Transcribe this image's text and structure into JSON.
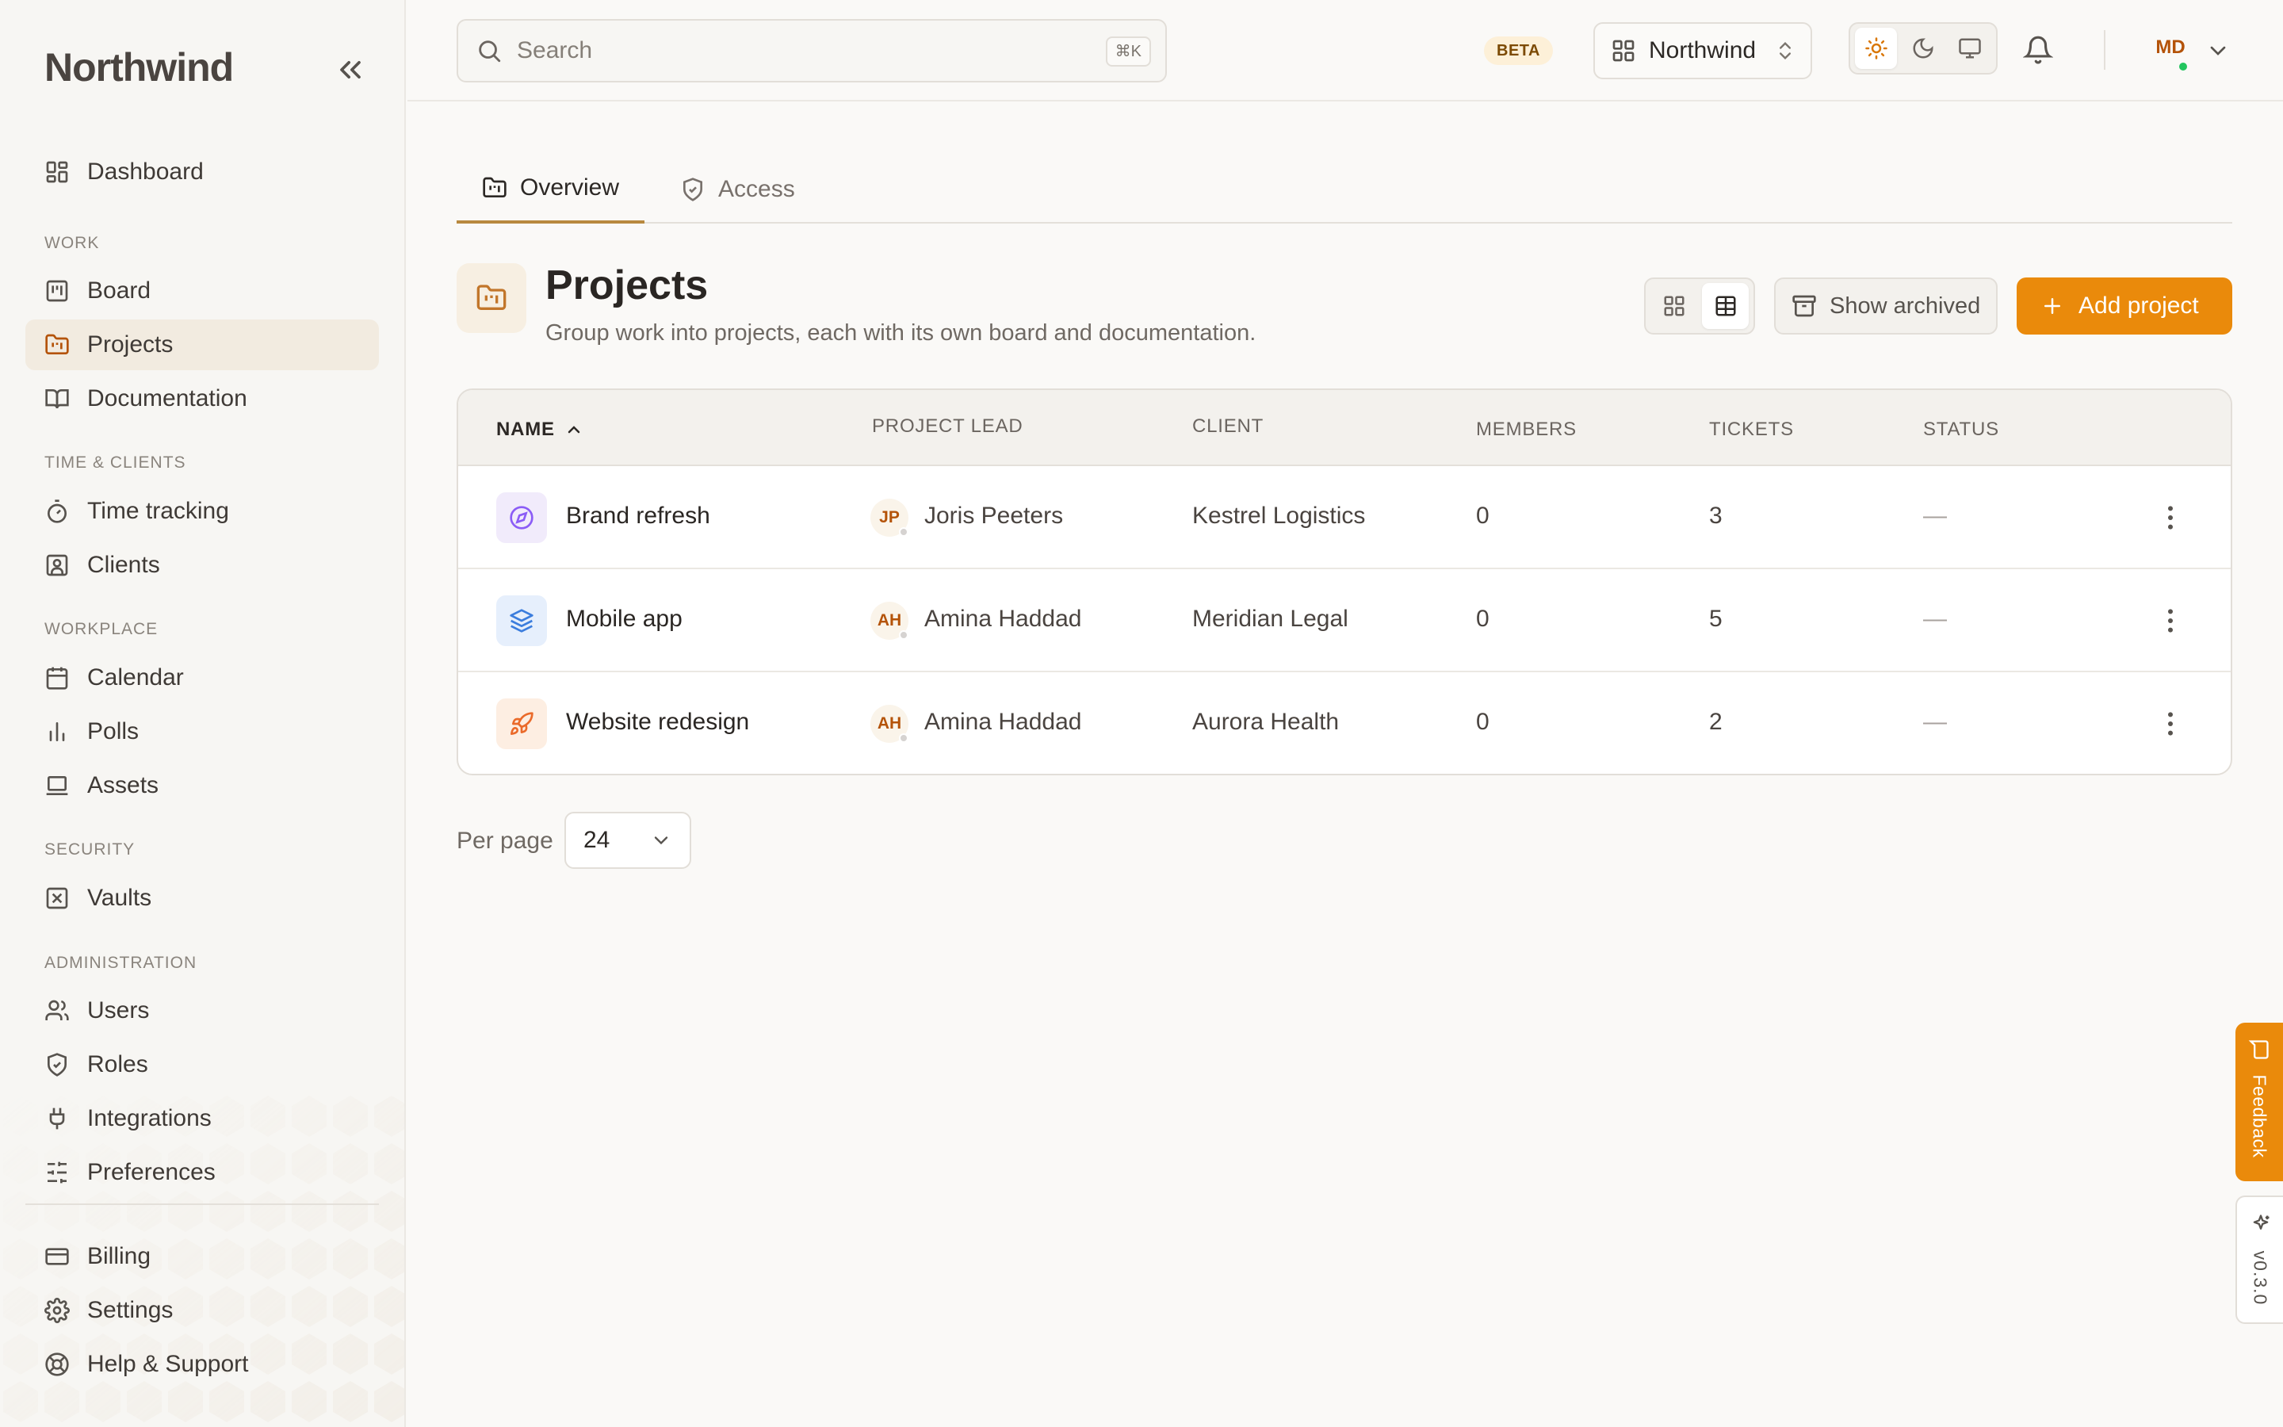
{
  "sidebar": {
    "logo": "Northwind",
    "items": {
      "dashboard": "Dashboard",
      "board": "Board",
      "projects": "Projects",
      "documentation": "Documentation",
      "time_tracking": "Time tracking",
      "clients": "Clients",
      "calendar": "Calendar",
      "polls": "Polls",
      "assets": "Assets",
      "vaults": "Vaults",
      "users": "Users",
      "roles": "Roles",
      "integrations": "Integrations",
      "preferences": "Preferences",
      "billing": "Billing",
      "settings": "Settings",
      "help": "Help & Support"
    },
    "sections": {
      "work": "Work",
      "time_clients": "Time & Clients",
      "workplace": "Workplace",
      "security": "Security",
      "administration": "Administration"
    }
  },
  "topbar": {
    "search_placeholder": "Search",
    "search_shortcut": "⌘K",
    "beta": "BETA",
    "workspace": "Northwind",
    "avatar_initials": "MD"
  },
  "tabs": {
    "overview": "Overview",
    "access": "Access"
  },
  "page": {
    "title": "Projects",
    "subtitle": "Group work into projects, each with its own board and documentation.",
    "show_archived": "Show archived",
    "add_project": "Add project"
  },
  "table": {
    "headers": {
      "name": "Name",
      "lead": "Project lead",
      "client": "Client",
      "members": "Members",
      "tickets": "Tickets",
      "status": "Status"
    },
    "rows": [
      {
        "name": "Brand refresh",
        "lead_initials": "JP",
        "lead": "Joris Peeters",
        "client": "Kestrel Logistics",
        "members": "0",
        "tickets": "3",
        "status": "—",
        "icon": "compass-icon",
        "icon_bg": "#f1ebfb",
        "icon_color": "#8b5cf6"
      },
      {
        "name": "Mobile app",
        "lead_initials": "AH",
        "lead": "Amina Haddad",
        "client": "Meridian Legal",
        "members": "0",
        "tickets": "5",
        "status": "—",
        "icon": "layers-icon",
        "icon_bg": "#e6effc",
        "icon_color": "#3b7ddd"
      },
      {
        "name": "Website redesign",
        "lead_initials": "AH",
        "lead": "Amina Haddad",
        "client": "Aurora Health",
        "members": "0",
        "tickets": "2",
        "status": "—",
        "icon": "rocket-icon",
        "icon_bg": "#fdeee2",
        "icon_color": "#ea6a2a"
      }
    ]
  },
  "pagination": {
    "per_page_label": "Per page",
    "per_page_value": "24"
  },
  "floating": {
    "feedback": "Feedback",
    "version": "v0.3.0"
  },
  "colors": {
    "accent": "#ea8a0b",
    "active_nav_bg": "#f2ebe0",
    "status_online": "#22c55e"
  }
}
